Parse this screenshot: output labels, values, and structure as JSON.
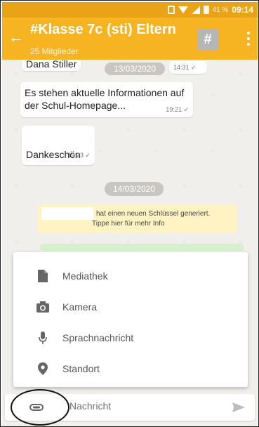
{
  "status_bar": {
    "battery": "41 %",
    "time": "09:14"
  },
  "toolbar": {
    "title": "#Klasse 7c (sti) Eltern",
    "subtitle": "25 Mitglieder",
    "hash_label": "#"
  },
  "messages": [
    {
      "text": "Dana Stiller",
      "date": "13/03/2020",
      "time": "14:31"
    },
    {
      "text": "Es stehen aktuelle Informationen auf der Schul-Homepage...",
      "time": "19:21"
    },
    {
      "text": "Dankeschön",
      "time": "19:23"
    }
  ],
  "dates": [
    "13/03/2020",
    "14/03/2020"
  ],
  "system_note": {
    "line1": "hat einen neuen Schlüssel generiert.",
    "line2": "Tippe hier für mehr Info"
  },
  "attach_menu": [
    {
      "label": "Mediathek",
      "icon": "document-icon"
    },
    {
      "label": "Kamera",
      "icon": "camera-icon"
    },
    {
      "label": "Sprachnachricht",
      "icon": "microphone-icon"
    },
    {
      "label": "Standort",
      "icon": "location-icon"
    }
  ],
  "composer": {
    "placeholder": "Nachricht"
  },
  "colors": {
    "status_bar": "#e9a317",
    "toolbar": "#f6b422",
    "chat_bg": "#f1efec",
    "system_note_bg": "#fff3c4"
  }
}
